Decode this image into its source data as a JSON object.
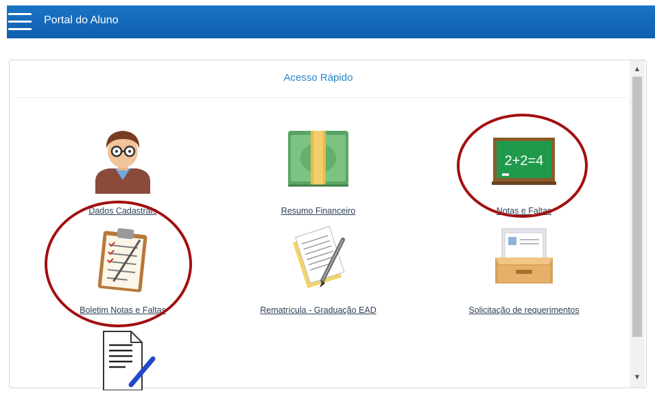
{
  "header": {
    "title": "Portal do Aluno"
  },
  "panel": {
    "title": "Acesso Rápido"
  },
  "shortcuts": [
    {
      "label": "Dados Cadastrais",
      "icon": "student-avatar-icon"
    },
    {
      "label": "Resumo Financeiro",
      "icon": "money-stack-icon"
    },
    {
      "label": "Notas e Faltas",
      "icon": "chalkboard-icon",
      "icon_text": "2+2=4",
      "highlighted": true
    },
    {
      "label": "Boletim Notas e Faltas",
      "icon": "clipboard-icon",
      "highlighted": true
    },
    {
      "label": "Rematrícula - Graduação EAD",
      "icon": "document-pen-icon"
    },
    {
      "label": "Solicitação de requerimentos",
      "icon": "file-tray-icon"
    },
    {
      "label": "",
      "icon": "text-document-pencil-icon"
    }
  ],
  "colors": {
    "header": "#1a6fc2",
    "accent": "#2a86c8",
    "highlight_ring": "#a30f10"
  }
}
